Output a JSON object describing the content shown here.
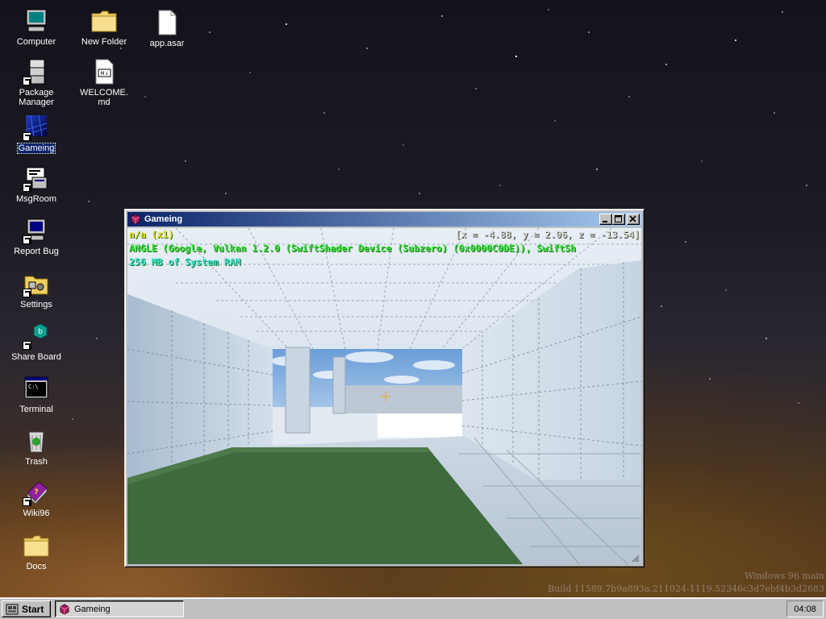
{
  "desktop": {
    "icons": [
      {
        "label": "Computer",
        "icon": "computer-icon"
      },
      {
        "label": "Package Manager",
        "icon": "package-manager-icon"
      },
      {
        "label": "Gameing",
        "icon": "gameing-icon"
      },
      {
        "label": "MsgRoom",
        "icon": "msgroom-icon"
      },
      {
        "label": "Report Bug",
        "icon": "report-bug-icon"
      },
      {
        "label": "Settings",
        "icon": "settings-icon"
      },
      {
        "label": "Share Board",
        "icon": "share-board-icon"
      },
      {
        "label": "Terminal",
        "icon": "terminal-icon"
      },
      {
        "label": "Trash",
        "icon": "trash-icon"
      },
      {
        "label": "Wiki96",
        "icon": "wiki96-icon"
      },
      {
        "label": "Docs",
        "icon": "folder-icon"
      },
      {
        "label": "New Folder",
        "icon": "folder-icon"
      },
      {
        "label": "WELCOME.md",
        "icon": "markdown-file-icon"
      },
      {
        "label": "app.asar",
        "icon": "file-icon"
      }
    ],
    "watermark": {
      "line1": "Windows 96 main",
      "line2": "Build 11589.7b9a893a.211024-1119.52346c3d7ebf4b3d2683"
    }
  },
  "window": {
    "title": "Gameing",
    "hud": {
      "fps": "n/a (x1)",
      "coords": "[x = -4.88, y = 2.06, z = -13.54]",
      "renderer": "ANGLE (Google, Vulkan 1.2.0 (SwiftShader Device (Subzero) (0x0000C0DE)), SwiftSh",
      "ram": "256 MB of System RAM"
    },
    "colors": {
      "hud_yellow": "#e8e000",
      "hud_green": "#30e830",
      "hud_cyan": "#30e8d0",
      "hud_coords": "#d8d8c8"
    }
  },
  "taskbar": {
    "start_label": "Start",
    "task_label": "Gameing",
    "clock": "04:08"
  }
}
